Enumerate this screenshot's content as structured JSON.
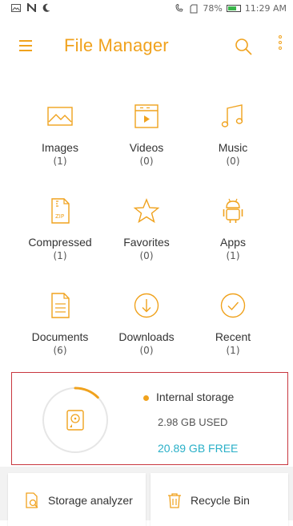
{
  "status_bar": {
    "left_icons": [
      "image-icon",
      "n-icon",
      "moon-icon"
    ],
    "battery": "78%",
    "time": "11:29 AM"
  },
  "appbar": {
    "title": "File Manager"
  },
  "categories": [
    {
      "label": "Images",
      "count": "(1)",
      "icon": "image-icon"
    },
    {
      "label": "Videos",
      "count": "(0)",
      "icon": "video-icon"
    },
    {
      "label": "Music",
      "count": "(0)",
      "icon": "music-icon"
    },
    {
      "label": "Compressed",
      "count": "(1)",
      "icon": "zip-icon"
    },
    {
      "label": "Favorites",
      "count": "(0)",
      "icon": "star-icon"
    },
    {
      "label": "Apps",
      "count": "(1)",
      "icon": "android-icon"
    },
    {
      "label": "Documents",
      "count": "(6)",
      "icon": "document-icon"
    },
    {
      "label": "Downloads",
      "count": "(0)",
      "icon": "download-icon"
    },
    {
      "label": "Recent",
      "count": "(1)",
      "icon": "check-circle-icon"
    }
  ],
  "storage": {
    "name": "Internal storage",
    "used": "2.98 GB USED",
    "free": "20.89 GB FREE",
    "used_fraction": 0.125
  },
  "bottom_cards": [
    {
      "label": "Storage analyzer",
      "icon": "storage-analyzer-icon"
    },
    {
      "label": "Recycle Bin",
      "icon": "trash-icon"
    }
  ],
  "colors": {
    "accent": "#f0a21d",
    "free_text": "#2ab0c8",
    "highlight_border": "#c8373f"
  }
}
